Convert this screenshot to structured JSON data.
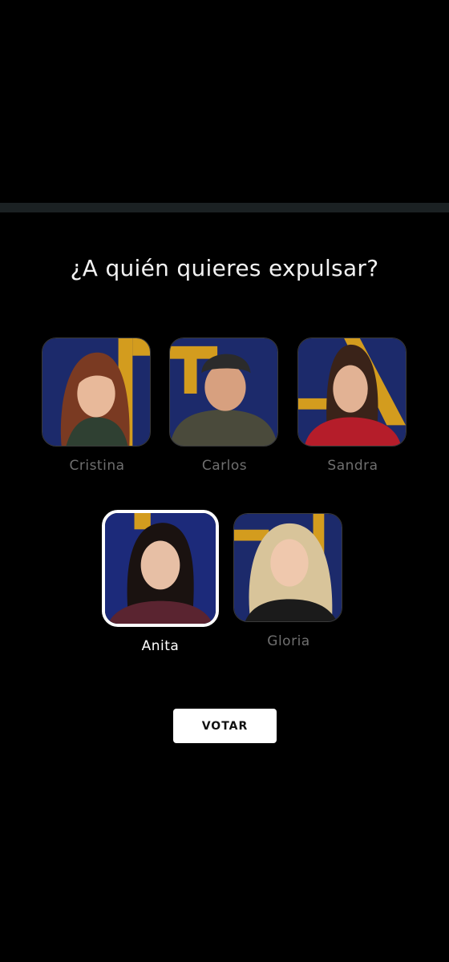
{
  "question": "¿A quién quieres expulsar?",
  "contestants": [
    {
      "name": "Cristina",
      "selected": false,
      "background_color": "#1c2a6b",
      "accent_color": "#d39c1e",
      "hair_color": "#7a3a22",
      "shirt_color": "#2f4032"
    },
    {
      "name": "Carlos",
      "selected": false,
      "background_color": "#1c2a6b",
      "accent_color": "#d39c1e",
      "hair_color": "#2b2b2b",
      "shirt_color": "#4a4a3b"
    },
    {
      "name": "Sandra",
      "selected": false,
      "background_color": "#1c2a6b",
      "accent_color": "#d39c1e",
      "hair_color": "#3a2319",
      "shirt_color": "#b51d2a"
    },
    {
      "name": "Anita",
      "selected": true,
      "background_color": "#1c2a7a",
      "accent_color": "#d39c1e",
      "hair_color": "#1a1210",
      "shirt_color": "#5a2430"
    },
    {
      "name": "Gloria",
      "selected": false,
      "background_color": "#1c2a6b",
      "accent_color": "#d39c1e",
      "hair_color": "#d8c49a",
      "shirt_color": "#1b1b1b"
    }
  ],
  "vote_button_label": "VOTAR",
  "colors": {
    "background": "#000000",
    "divider": "#1b2123",
    "unselected_name": "#6f6f6f",
    "selected_name": "#ffffff"
  }
}
